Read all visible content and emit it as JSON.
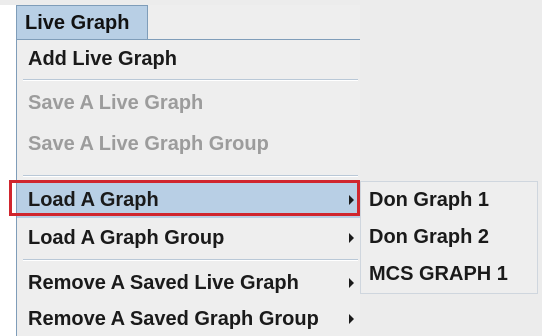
{
  "menubar": {
    "title": "Live Graph"
  },
  "menu": {
    "items": [
      {
        "label": "Add Live Graph",
        "enabled": true,
        "submenu": false
      },
      {
        "label": "Save A Live Graph",
        "enabled": false,
        "submenu": false
      },
      {
        "label": "Save A Live Graph Group",
        "enabled": false,
        "submenu": false
      },
      {
        "label": "Load A Graph",
        "enabled": true,
        "submenu": true,
        "selected": true
      },
      {
        "label": "Load A Graph Group",
        "enabled": true,
        "submenu": true
      },
      {
        "label": "Remove A Saved Live Graph",
        "enabled": true,
        "submenu": true
      },
      {
        "label": "Remove A Saved Graph Group",
        "enabled": true,
        "submenu": true
      }
    ]
  },
  "submenu": {
    "items": [
      {
        "label": "Don Graph 1"
      },
      {
        "label": "Don Graph 2"
      },
      {
        "label": "MCS GRAPH 1"
      }
    ]
  },
  "colors": {
    "menu_background": "#eeeeee",
    "selection": "#b8cfe5",
    "disabled_text": "#9c9c9c",
    "highlight_outline": "#d0262e",
    "border": "#7f9db9"
  },
  "icons": {
    "submenu_arrow": "chevron-right-icon"
  }
}
